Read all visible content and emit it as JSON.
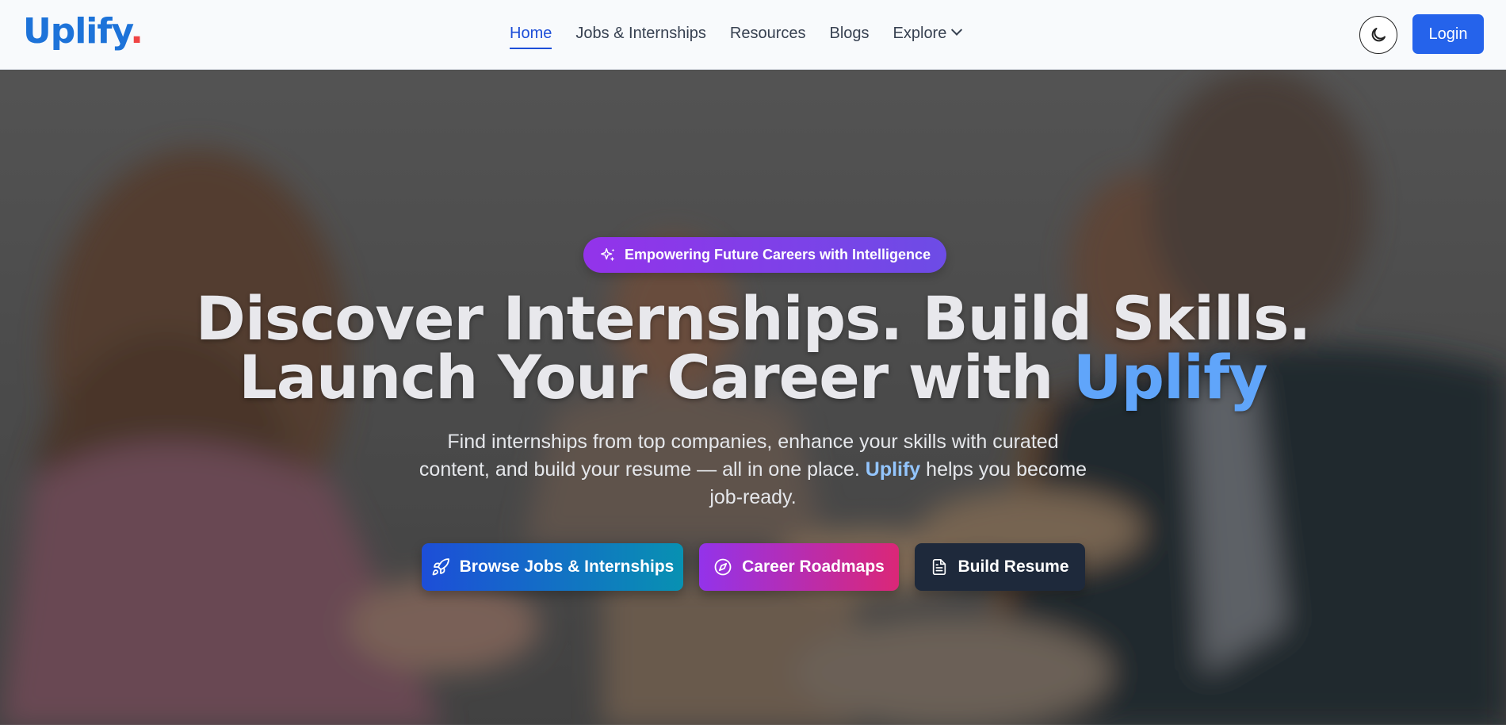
{
  "nav": {
    "logo_text": "Uplify",
    "logo_dot": ".",
    "links": [
      {
        "label": "Home"
      },
      {
        "label": "Jobs & Internships"
      },
      {
        "label": "Resources"
      },
      {
        "label": "Blogs"
      },
      {
        "label": "Explore"
      }
    ],
    "login_label": "Login",
    "theme_icon": "moon-icon"
  },
  "hero": {
    "badge_text": "Empowering Future Careers with Intelligence",
    "headline_line1": "Discover Internships. Build Skills.",
    "headline_line2_prefix": "Launch Your Career with ",
    "headline_accent": "Uplify",
    "subtext_before": "Find internships from top companies, enhance your skills with curated content, and build your resume — all in one place. ",
    "subtext_accent": "Uplify",
    "subtext_after": " helps you become job-ready.",
    "buttons": {
      "browse": "Browse Jobs & Internships",
      "roadmaps": "Career Roadmaps",
      "resume": "Build Resume"
    }
  },
  "colors": {
    "brand": "#1d73d9",
    "login": "#2563eb",
    "accent_text": "#60a5fa"
  }
}
